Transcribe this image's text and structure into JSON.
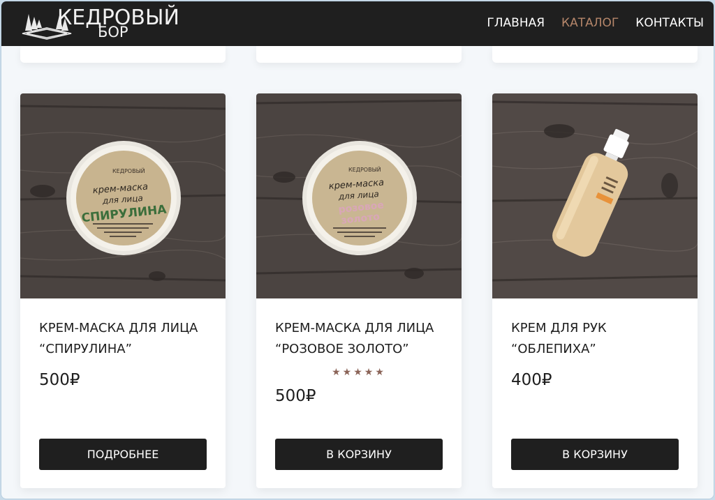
{
  "header": {
    "logo_line1": "КЕДРОВЫЙ",
    "logo_line2": "БОР",
    "nav": [
      {
        "label": "ГЛАВНАЯ",
        "active": false
      },
      {
        "label": "КАТАЛОГ",
        "active": true
      },
      {
        "label": "КОНТАКТЫ",
        "active": false
      }
    ]
  },
  "products": [
    {
      "title_line1": "КРЕМ-МАСКА ДЛЯ ЛИЦА",
      "title_line2": "“СПИРУЛИНА”",
      "price": "500₽",
      "rating_stars": 0,
      "button": "ПОДРОБНЕЕ",
      "image": "jar-spirulina",
      "jar_label": [
        "КЕДРОВЫЙ",
        "крем-маска",
        "для лица",
        "СПИРУЛИНА"
      ]
    },
    {
      "title_line1": "КРЕМ-МАСКА ДЛЯ ЛИЦА",
      "title_line2": "“РОЗОВОЕ ЗОЛОТО”",
      "price": "500₽",
      "rating_stars": 5,
      "stars_text": "★★★★★",
      "button": "В КОРЗИНУ",
      "image": "jar-rose-gold",
      "jar_label": [
        "КЕДРОВЫЙ",
        "крем-маска",
        "для лица",
        "розовое",
        "золото"
      ]
    },
    {
      "title_line1": "КРЕМ ДЛЯ РУК",
      "title_line2": "“ОБЛЕПИХА”",
      "price": "400₽",
      "rating_stars": 0,
      "button": "В КОРЗИНУ",
      "image": "bottle-sea-buckthorn"
    }
  ],
  "colors": {
    "header_bg": "#1f1f1f",
    "nav_active": "#b5866a",
    "button_bg": "#1f1f1f",
    "star": "#8b6458"
  }
}
